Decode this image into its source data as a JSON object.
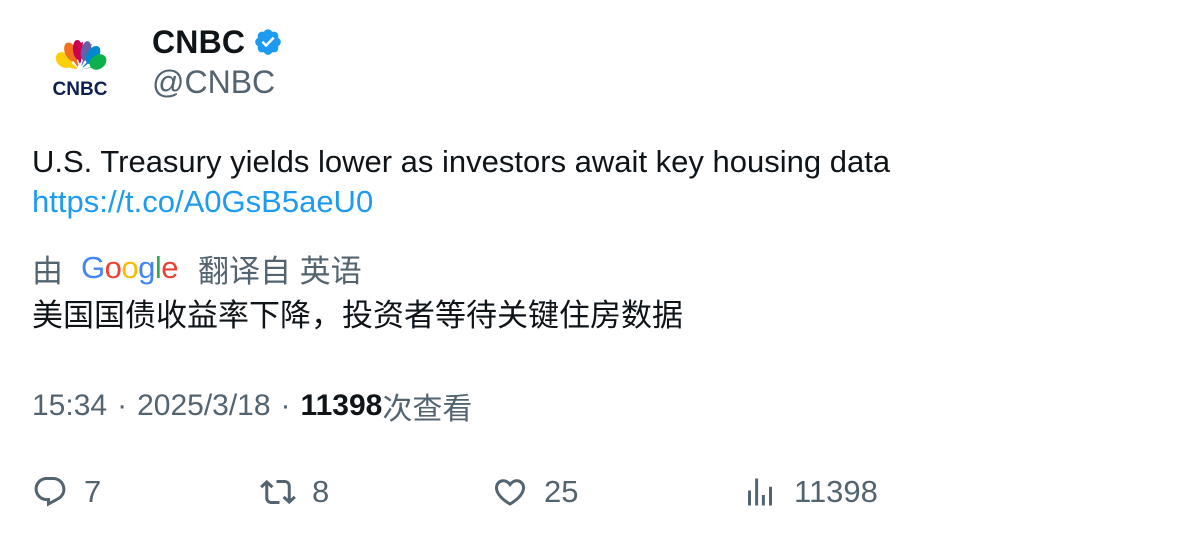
{
  "author": {
    "display_name": "CNBC",
    "handle": "@CNBC",
    "avatar_logo_text": "CNBC",
    "verified": true
  },
  "tweet": {
    "text": "U.S. Treasury yields lower as investors await key housing data",
    "link": "https://t.co/A0GsB5aeU0"
  },
  "translation": {
    "by_label": "由",
    "provider": "Google",
    "translated_from_label": "翻译自 英语",
    "text": "美国国债收益率下降，投资者等待关键住房数据"
  },
  "meta": {
    "time": "15:34",
    "separator": "·",
    "date": "2025/3/18",
    "views_count": "11398",
    "views_label": "次查看"
  },
  "actions": {
    "replies": "7",
    "retweets": "8",
    "likes": "25",
    "views": "11398"
  },
  "colors": {
    "text_primary": "#0f1419",
    "text_secondary": "#536471",
    "link": "#1d9bf0",
    "verified_badge": "#1d9bf0"
  },
  "icons": {
    "reply": "reply-icon",
    "retweet": "retweet-icon",
    "like": "heart-icon",
    "views": "bar-chart-icon",
    "verified": "verified-badge-icon"
  }
}
